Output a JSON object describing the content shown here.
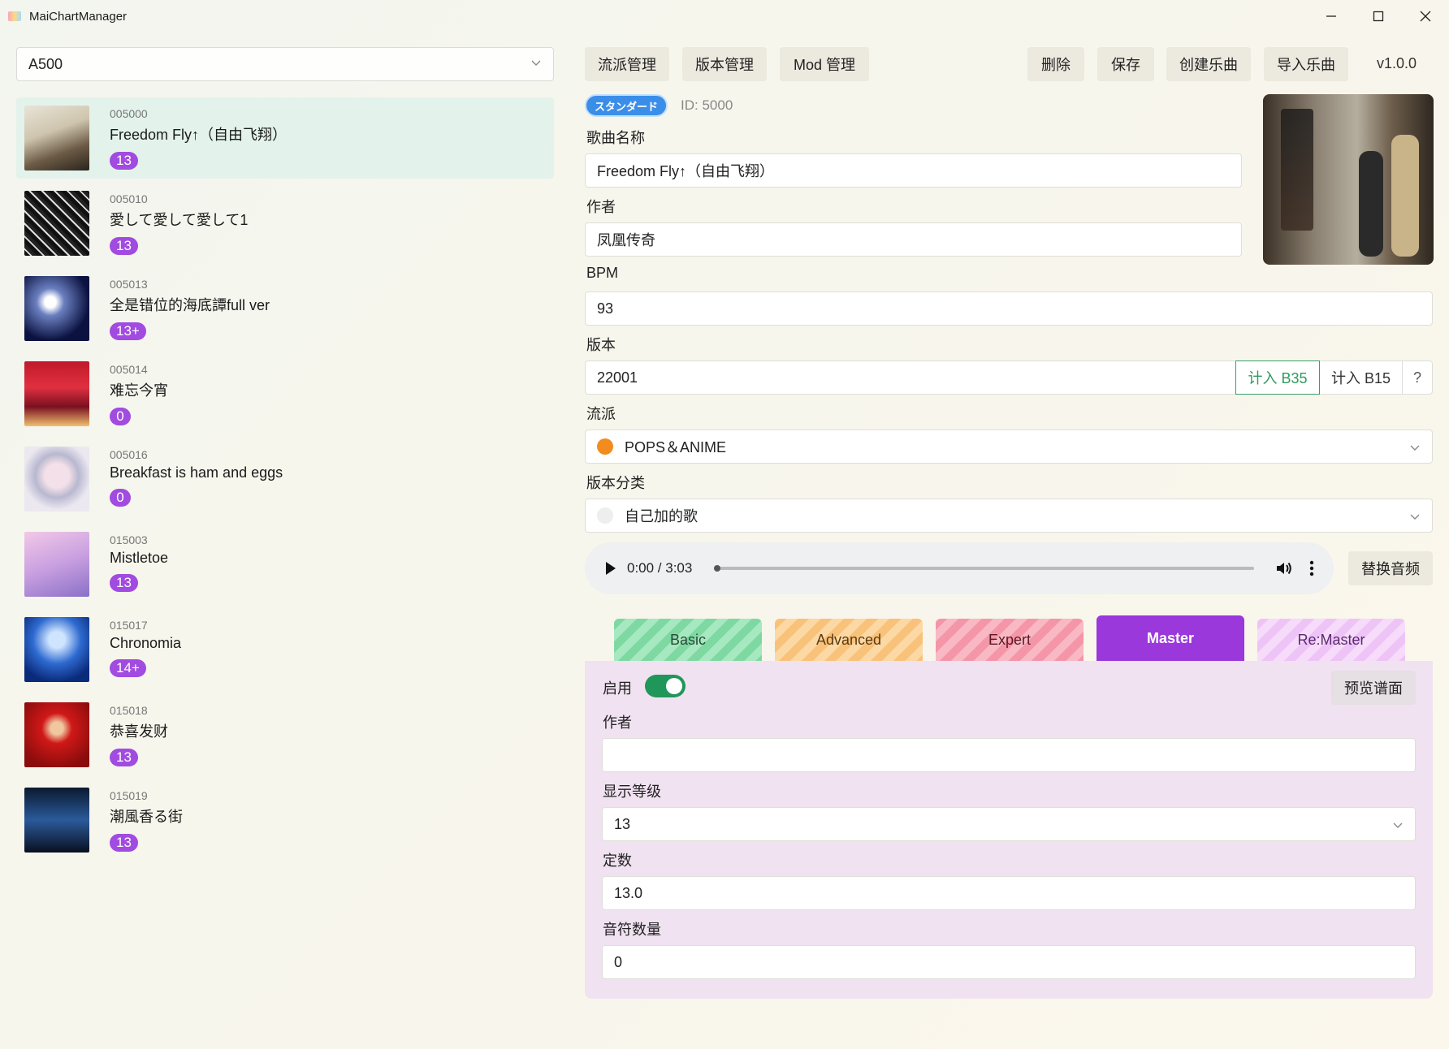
{
  "window": {
    "title": "MaiChartManager"
  },
  "left": {
    "source_select": "A500",
    "songs": [
      {
        "id": "005000",
        "name": "Freedom Fly↑（自由飞翔）",
        "level": "13"
      },
      {
        "id": "005010",
        "name": "愛して愛して愛して1",
        "level": "13"
      },
      {
        "id": "005013",
        "name": "全是错位的海底譚full ver",
        "level": "13+"
      },
      {
        "id": "005014",
        "name": "难忘今宵",
        "level": "0"
      },
      {
        "id": "005016",
        "name": "Breakfast is ham and eggs",
        "level": "0"
      },
      {
        "id": "015003",
        "name": "Mistletoe",
        "level": "13"
      },
      {
        "id": "015017",
        "name": "Chronomia",
        "level": "14+"
      },
      {
        "id": "015018",
        "name": "恭喜发财",
        "level": "13"
      },
      {
        "id": "015019",
        "name": "潮風香る街",
        "level": "13"
      }
    ]
  },
  "toolbar": {
    "genre_mgmt": "流派管理",
    "version_mgmt": "版本管理",
    "mod_mgmt": "Mod 管理",
    "delete": "删除",
    "save": "保存",
    "create": "创建乐曲",
    "import": "导入乐曲",
    "app_version": "v1.0.0"
  },
  "song": {
    "badge": "スタンダード",
    "id_text": "ID: 5000",
    "title_label": "歌曲名称",
    "title_value": "Freedom Fly↑（自由飞翔）",
    "artist_label": "作者",
    "artist_value": "凤凰传奇",
    "bpm_label": "BPM",
    "bpm_value": "93",
    "version_label": "版本",
    "version_value": "22001",
    "b35": "计入 B35",
    "b15": "计入 B15",
    "help": "?",
    "genre_label": "流派",
    "genre_value": "POPS＆ANIME",
    "genre_color": "#f28c1f",
    "vcat_label": "版本分类",
    "vcat_value": "自己加的歌",
    "vcat_color": "#eeeeee"
  },
  "audio": {
    "time": "0:00 / 3:03",
    "replace": "替换音频"
  },
  "difficulty": {
    "tabs": [
      "Basic",
      "Advanced",
      "Expert",
      "Master",
      "Re:Master"
    ],
    "active": "Master"
  },
  "chart": {
    "enable_label": "启用",
    "enabled": true,
    "preview": "预览谱面",
    "designer_label": "作者",
    "designer_value": "",
    "display_level_label": "显示等级",
    "display_level_value": "13",
    "constant_label": "定数",
    "constant_value": "13.0",
    "notes_label": "音符数量",
    "notes_value": "0"
  }
}
